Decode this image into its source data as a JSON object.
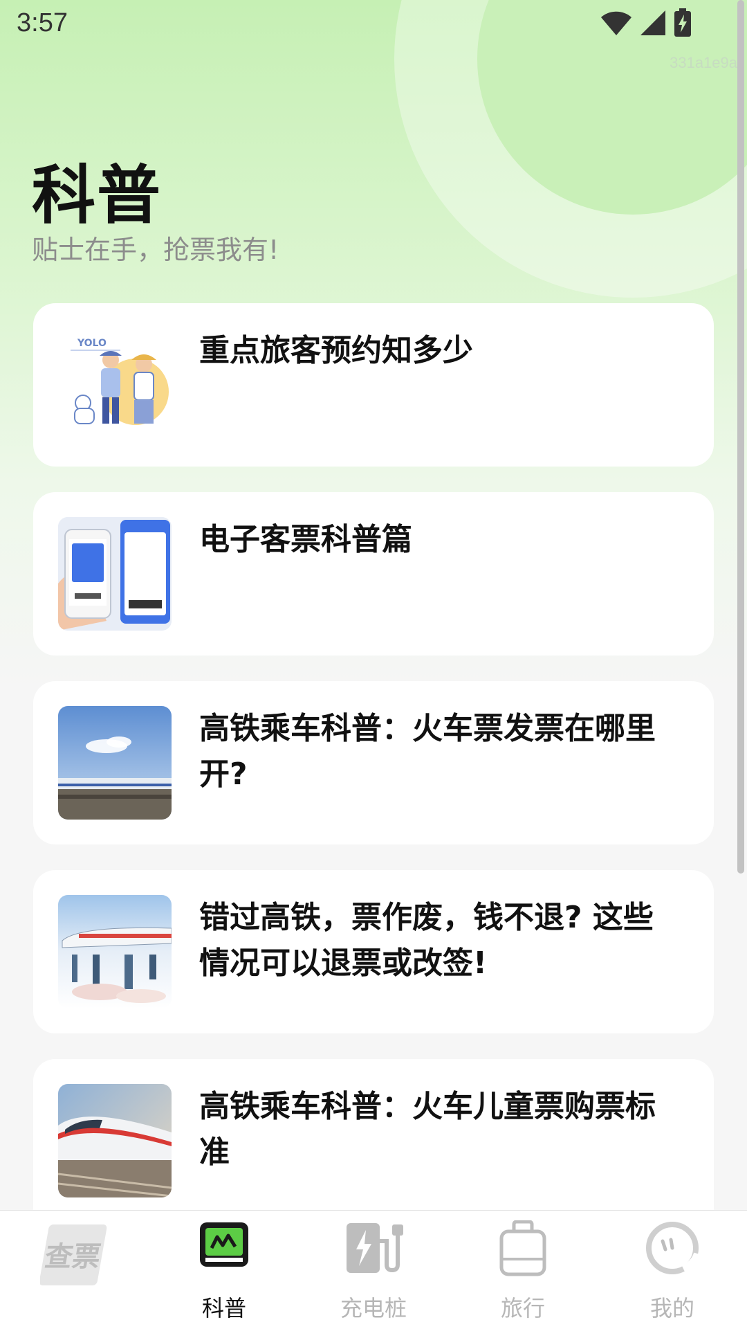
{
  "status_bar": {
    "time": "3:57",
    "icons": [
      "wifi-icon",
      "cellular-signal-icon",
      "battery-charging-icon"
    ]
  },
  "device_id": "331a1e9a",
  "header": {
    "title": "科普",
    "subtitle": "贴士在手，抢票我有!"
  },
  "articles": [
    {
      "title": "重点旅客预约知多少",
      "thumbnail": "travelers-illustration",
      "thumb_text": "YOLO"
    },
    {
      "title": "电子客票科普篇",
      "thumbnail": "e-ticket-phone-image"
    },
    {
      "title": "高铁乘车科普：火车票发票在哪里开?",
      "thumbnail": "bullet-train-sky-image"
    },
    {
      "title": "错过高铁，票作废，钱不退? 这些情况可以退票或改签!",
      "thumbnail": "bullet-train-reflection-image"
    },
    {
      "title": "高铁乘车科普：火车儿童票购票标准",
      "thumbnail": "bullet-train-speed-image"
    }
  ],
  "tab_bar": {
    "tabs": [
      {
        "label": "",
        "icon": "ticket-logo-icon",
        "logo_text": "查票",
        "active": false
      },
      {
        "label": "科普",
        "icon": "science-tab-icon",
        "active": true
      },
      {
        "label": "充电桩",
        "icon": "charging-station-icon",
        "active": false
      },
      {
        "label": "旅行",
        "icon": "luggage-icon",
        "active": false
      },
      {
        "label": "我的",
        "icon": "profile-face-icon",
        "active": false
      }
    ]
  },
  "colors": {
    "header_gradient_top": "#c6f0b4",
    "background": "#f6f6f6",
    "card": "#ffffff",
    "accent_green": "#5ccd45",
    "inactive_tab": "#b6b6b6"
  }
}
